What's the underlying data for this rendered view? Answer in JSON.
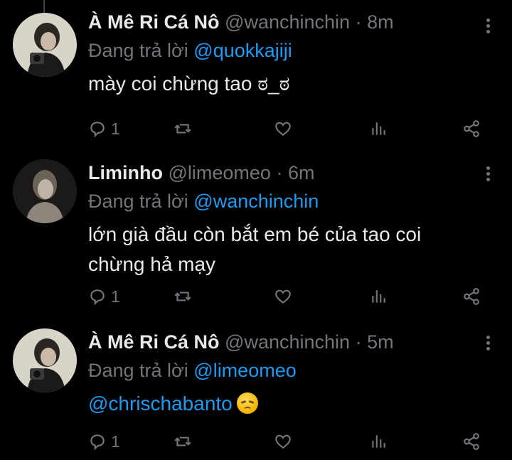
{
  "tweets": [
    {
      "name": "À Mê Ri Cá Nô",
      "handle": "@wanchinchin",
      "time": "8m",
      "replying_prefix": "Đang trả lời",
      "replying_to": "@quokkajiji",
      "text": "mày coi chừng tao ಠ_ಠ",
      "mention_text": "",
      "reply_count": "1"
    },
    {
      "name": "Liminho",
      "handle": "@limeomeo",
      "time": "6m",
      "replying_prefix": "Đang trả lời",
      "replying_to": "@wanchinchin",
      "text": "lớn già đầu còn bắt em bé của tao coi chừng hả mạy",
      "mention_text": "",
      "reply_count": "1"
    },
    {
      "name": "À Mê Ri Cá Nô",
      "handle": "@wanchinchin",
      "time": "5m",
      "replying_prefix": "Đang trả lời",
      "replying_to": "@limeomeo",
      "text": "",
      "mention_text": "@chrischabanto",
      "reply_count": "1"
    }
  ],
  "separator": "·",
  "icons": [
    "reply-icon",
    "retweet-icon",
    "like-icon",
    "analytics-icon",
    "share-icon",
    "more-icon",
    "disappointed-emoji"
  ],
  "colors": {
    "background": "#000000",
    "text": "#e7e9ea",
    "muted": "#71767b",
    "link": "#1d9bf0",
    "thread": "#3e4144"
  }
}
